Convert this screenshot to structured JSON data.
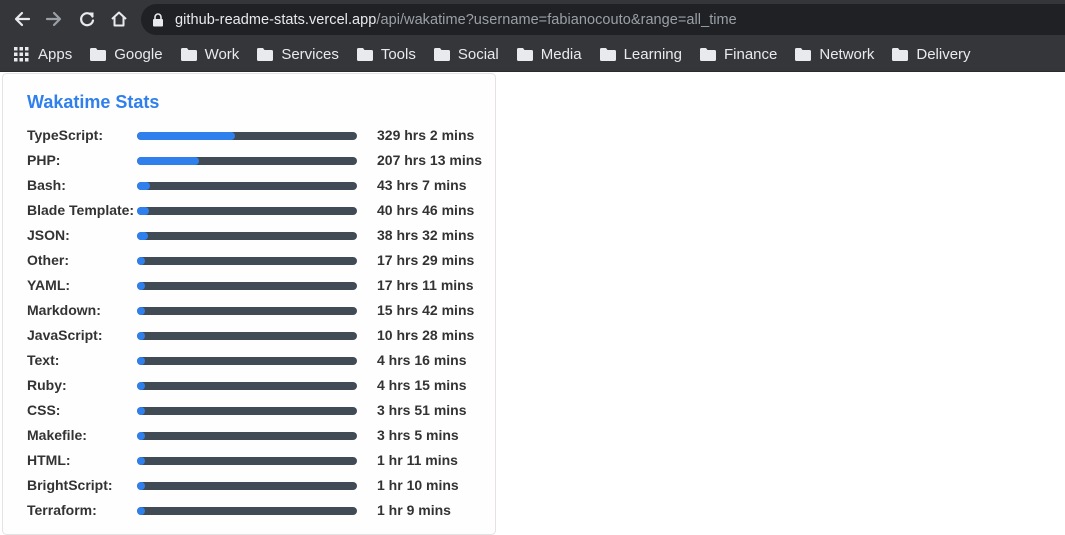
{
  "browser": {
    "url_host": "github-readme-stats.vercel.app",
    "url_path": "/api/wakatime?username=fabianocouto&range=all_time",
    "bookmarks": [
      "Apps",
      "Google",
      "Work",
      "Services",
      "Tools",
      "Social",
      "Media",
      "Learning",
      "Finance",
      "Network",
      "Delivery"
    ]
  },
  "card": {
    "title": "Wakatime Stats",
    "accent_color": "#2f80ed",
    "track_color": "#414b55",
    "languages": [
      {
        "name": "TypeScript:",
        "time": "329 hrs 2 mins",
        "percent": 44.7
      },
      {
        "name": "PHP:",
        "time": "207 hrs 13 mins",
        "percent": 28.1
      },
      {
        "name": "Bash:",
        "time": "43 hrs 7 mins",
        "percent": 5.9
      },
      {
        "name": "Blade Template:",
        "time": "40 hrs 46 mins",
        "percent": 5.5
      },
      {
        "name": "JSON:",
        "time": "38 hrs 32 mins",
        "percent": 5.2
      },
      {
        "name": "Other:",
        "time": "17 hrs 29 mins",
        "percent": 2.4
      },
      {
        "name": "YAML:",
        "time": "17 hrs 11 mins",
        "percent": 2.3
      },
      {
        "name": "Markdown:",
        "time": "15 hrs 42 mins",
        "percent": 2.1
      },
      {
        "name": "JavaScript:",
        "time": "10 hrs 28 mins",
        "percent": 1.4
      },
      {
        "name": "Text:",
        "time": "4 hrs 16 mins",
        "percent": 0.6
      },
      {
        "name": "Ruby:",
        "time": "4 hrs 15 mins",
        "percent": 0.6
      },
      {
        "name": "CSS:",
        "time": "3 hrs 51 mins",
        "percent": 0.5
      },
      {
        "name": "Makefile:",
        "time": "3 hrs 5 mins",
        "percent": 0.4
      },
      {
        "name": "HTML:",
        "time": "1 hr 11 mins",
        "percent": 0.2
      },
      {
        "name": "BrightScript:",
        "time": "1 hr 10 mins",
        "percent": 0.2
      },
      {
        "name": "Terraform:",
        "time": "1 hr 9 mins",
        "percent": 0.2
      }
    ]
  }
}
